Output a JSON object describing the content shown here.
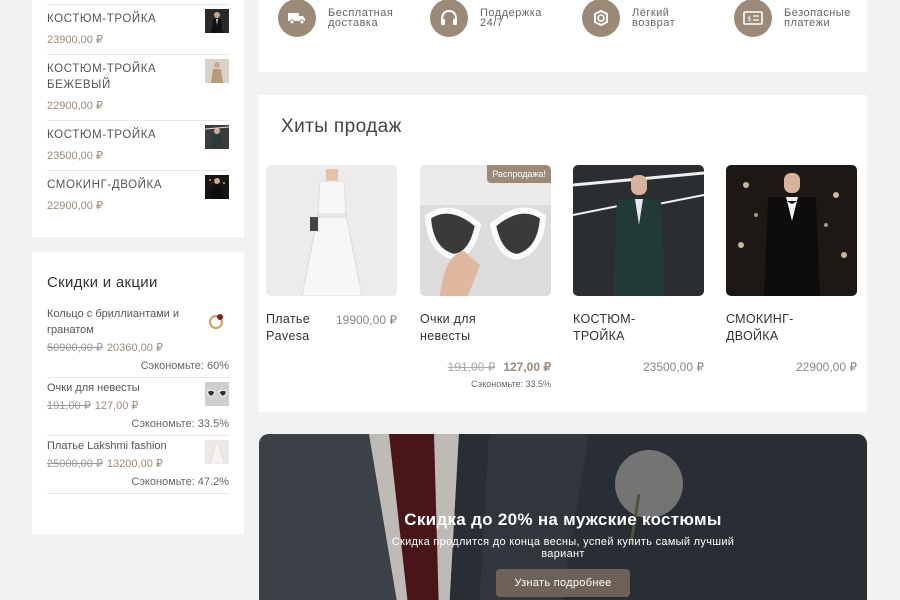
{
  "recent_products": [
    {
      "name": "КОСТЮМ-ТРОЙКА",
      "price": "23900,00 ₽",
      "thumb": "suit-dark"
    },
    {
      "name": "КОСТЮМ-ТРОЙКА БЕЖЕВЫЙ",
      "price": "22900,00 ₽",
      "thumb": "suit-beige"
    },
    {
      "name": "КОСТЮМ-ТРОЙКА",
      "price": "23500,00 ₽",
      "thumb": "suit-green"
    },
    {
      "name": "СМОКИНГ-ДВОЙКА",
      "price": "22900,00 ₽",
      "thumb": "tuxedo"
    }
  ],
  "sales": {
    "title": "Скидки и акции",
    "items": [
      {
        "name": "Кольцо с бриллиантами и гранатом",
        "old_price": "50900,00 ₽",
        "new_price": "20360,00 ₽",
        "save": "Сэкономьте: 60%",
        "thumb": "ring"
      },
      {
        "name": "Очки для невесты",
        "old_price": "191,00 ₽",
        "new_price": "127,00 ₽",
        "save": "Сэкономьте: 33.5%",
        "thumb": "glasses"
      },
      {
        "name": "Платье Lakshmi fashion",
        "old_price": "25000,00 ₽",
        "new_price": "13200,00 ₽",
        "save": "Сэкономьте: 47.2%",
        "thumb": "dress"
      }
    ]
  },
  "features": [
    {
      "label": "Бесплатная доставка",
      "icon": "truck-icon"
    },
    {
      "label": "Поддержка 24/7",
      "icon": "headphones-icon"
    },
    {
      "label": "Лёгкий возврат",
      "icon": "return-icon"
    },
    {
      "label": "Безопасные платежи",
      "icon": "payment-icon"
    }
  ],
  "bestsellers": {
    "title": "Хиты продаж",
    "products": [
      {
        "name": "Платье Pavesa",
        "price": "19900,00 ₽",
        "image": "white-dress"
      },
      {
        "name": "Очки для невесты",
        "badge": "Распродажа!",
        "old_price": "191,00 ₽",
        "new_price": "127,00 ₽",
        "save": "Сэкономьте: 33.5%",
        "image": "heart-glasses"
      },
      {
        "name": "КОСТЮМ-ТРОЙКА",
        "price": "23500,00 ₽",
        "image": "green-suit"
      },
      {
        "name": "СМОКИНГ-ДВОЙКА",
        "price": "22900,00 ₽",
        "image": "black-tuxedo"
      }
    ]
  },
  "banner": {
    "title": "Скидка до 20% на мужские костюмы",
    "subtitle": "Скидка продлится до конца весны, успей купить самый лучший вариант",
    "button": "Узнать подробнее"
  },
  "colors": {
    "accent": "#9b8a77",
    "background": "#f2f2f2"
  }
}
